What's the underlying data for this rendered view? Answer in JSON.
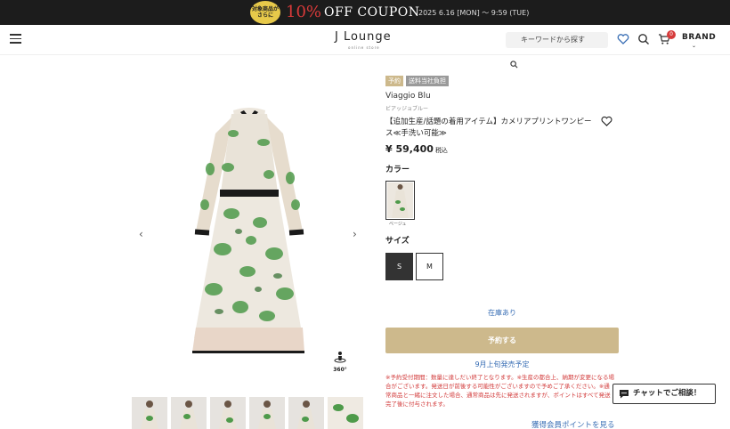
{
  "banner": {
    "badge": "対象商品がさらに",
    "big": "10%",
    "text": "OFF COUPON",
    "date": "2025 6.16 [MON] 〜 9:59 (TUE)"
  },
  "header": {
    "logo": "J Lounge",
    "logo_sub": "online store",
    "search_placeholder": "キーワードから探す",
    "cart_count": "0",
    "brand_label": "BRAND"
  },
  "product": {
    "tags": [
      "予約",
      "送料当社負担"
    ],
    "brand": "Viaggio Blu",
    "brand_kana": "ビアッジョブルー",
    "title": "【追加生産/話題の着用アイテム】カメリアプリントワンピース≪手洗い可能≫",
    "price": "¥ 59,400",
    "tax": "税込",
    "color_label": "カラー",
    "color_name": "ベージュ",
    "size_label": "サイズ",
    "sizes": [
      "S",
      "M"
    ],
    "stock": "在庫あり",
    "reserve_button": "予約する",
    "release": "9月上旬発売予定",
    "notes": "※予約受付期間：数量に達しだい終了となります。※生産の都合上、納期が変更になる場合がございます。発送日が前後する可能性がございますので予めご了承ください。※通常商品と一緒に注文した場合、通常商品は先に発送されますが、ポイントはすべて発送完了後に付与されます。",
    "points_link": "獲得会員ポイントを見る"
  },
  "gallery": {
    "label_360": "360°",
    "thumb_count": 6
  },
  "chat": {
    "label": "チャットでご相談！"
  },
  "colors": {
    "gold": "#cdb98c",
    "link": "#3a6fb5",
    "note_red": "#d23a3a"
  }
}
